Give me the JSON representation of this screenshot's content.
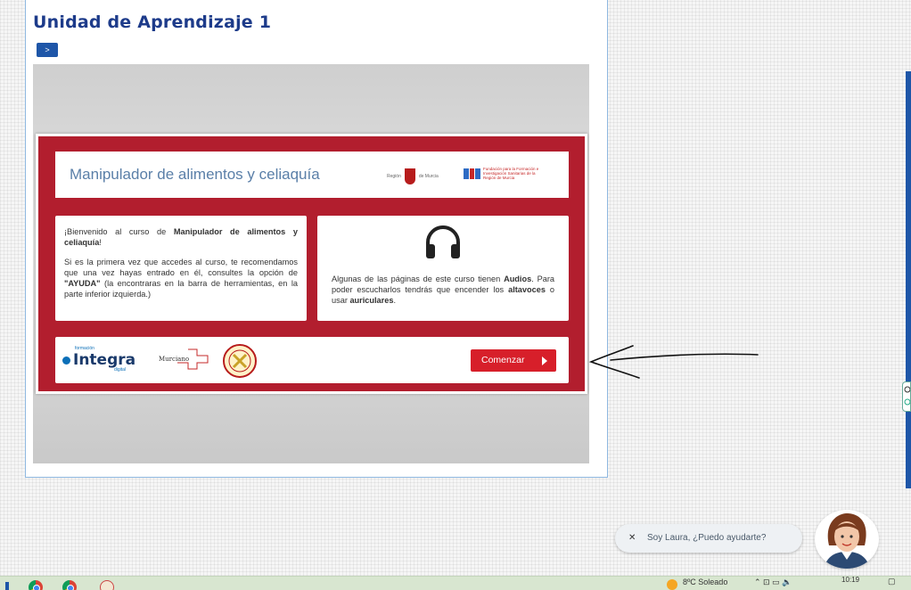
{
  "course": {
    "unit_title": "Unidad de Aprendizaje 1",
    "expand_label": ">"
  },
  "slide": {
    "title": "Manipulador de alimentos y celiaquía",
    "region_logo_text_left": "Región",
    "region_logo_text_right": "de Murcia",
    "ffis_logo_text": "Fundación para la Formación e Investigación Sanitarias de la Región de Murcia",
    "welcome": {
      "line1_pre": "¡Bienvenido al curso de ",
      "line1_bold": "Manipulador de alimentos y celiaquía",
      "line1_post": "!",
      "line2_pre": "Si es la primera vez que accedes al curso, te recomendamos que una vez hayas entrado en él, consultes la opción de ",
      "line2_bold": "\"AYUDA\"",
      "line2_post": " (la encontraras en la barra de herramientas, en la parte inferior izquierda.)"
    },
    "audio": {
      "icon": "headphones-icon",
      "pre": "Algunas de las páginas de este curso tienen ",
      "bold1": "Audios",
      "mid": ". Para poder escucharlos tendrás que encender los ",
      "bold2": "altavoces",
      "mid2": " o usar ",
      "bold3": "auriculares",
      "post": "."
    },
    "footer": {
      "integra_small": "formación",
      "integra_word": "Integra",
      "integra_sub": "digital",
      "murciano_text": "Murciano",
      "start_label": "Comenzar"
    }
  },
  "chat": {
    "close_label": "✕",
    "message": "Soy Laura, ¿Puedo ayudarte?"
  },
  "taskbar": {
    "weather": "8ºC  Soleado",
    "time": "10:19"
  },
  "colors": {
    "slide_red": "#b21e2e",
    "button_red": "#d71f2a",
    "title_blue": "#1d3b8a"
  }
}
